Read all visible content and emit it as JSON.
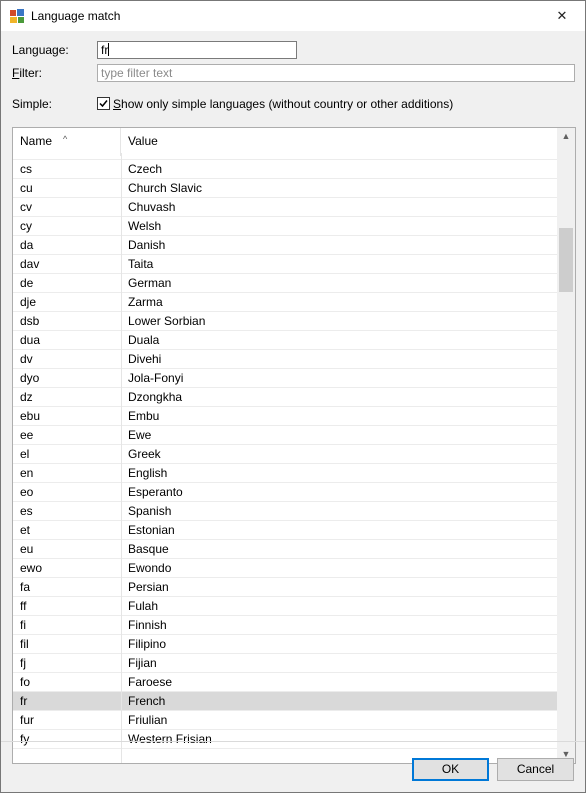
{
  "window": {
    "title": "Language match",
    "close_glyph": "✕"
  },
  "form": {
    "language_label": "Language:",
    "language_value": "fr",
    "filter_label_first": "F",
    "filter_label_rest": "ilter:",
    "filter_placeholder": "type filter text",
    "simple_label": "Simple:",
    "simple_checked": true,
    "simple_text_first": "S",
    "simple_text_rest": "how only simple languages (without country or other additions)"
  },
  "table": {
    "columns": [
      "Name",
      "Value"
    ],
    "sort_indicator": "^",
    "rows": [
      {
        "name": "",
        "value": ""
      },
      {
        "name": "cs",
        "value": "Czech"
      },
      {
        "name": "cu",
        "value": "Church Slavic"
      },
      {
        "name": "cv",
        "value": "Chuvash"
      },
      {
        "name": "cy",
        "value": "Welsh"
      },
      {
        "name": "da",
        "value": "Danish"
      },
      {
        "name": "dav",
        "value": "Taita"
      },
      {
        "name": "de",
        "value": "German"
      },
      {
        "name": "dje",
        "value": "Zarma"
      },
      {
        "name": "dsb",
        "value": "Lower Sorbian"
      },
      {
        "name": "dua",
        "value": "Duala"
      },
      {
        "name": "dv",
        "value": "Divehi"
      },
      {
        "name": "dyo",
        "value": "Jola-Fonyi"
      },
      {
        "name": "dz",
        "value": "Dzongkha"
      },
      {
        "name": "ebu",
        "value": "Embu"
      },
      {
        "name": "ee",
        "value": "Ewe"
      },
      {
        "name": "el",
        "value": "Greek"
      },
      {
        "name": "en",
        "value": "English"
      },
      {
        "name": "eo",
        "value": "Esperanto"
      },
      {
        "name": "es",
        "value": "Spanish"
      },
      {
        "name": "et",
        "value": "Estonian"
      },
      {
        "name": "eu",
        "value": "Basque"
      },
      {
        "name": "ewo",
        "value": "Ewondo"
      },
      {
        "name": "fa",
        "value": "Persian"
      },
      {
        "name": "ff",
        "value": "Fulah"
      },
      {
        "name": "fi",
        "value": "Finnish"
      },
      {
        "name": "fil",
        "value": "Filipino"
      },
      {
        "name": "fj",
        "value": "Fijian"
      },
      {
        "name": "fo",
        "value": "Faroese"
      },
      {
        "name": "fr",
        "value": "French",
        "selected": true
      },
      {
        "name": "fur",
        "value": "Friulian"
      },
      {
        "name": "fy",
        "value": "Western Frisian"
      }
    ]
  },
  "buttons": {
    "ok_label": "OK",
    "cancel_label": "Cancel"
  },
  "colors": {
    "selection": "#d9d9d9",
    "default_button_border": "#0078d7"
  }
}
